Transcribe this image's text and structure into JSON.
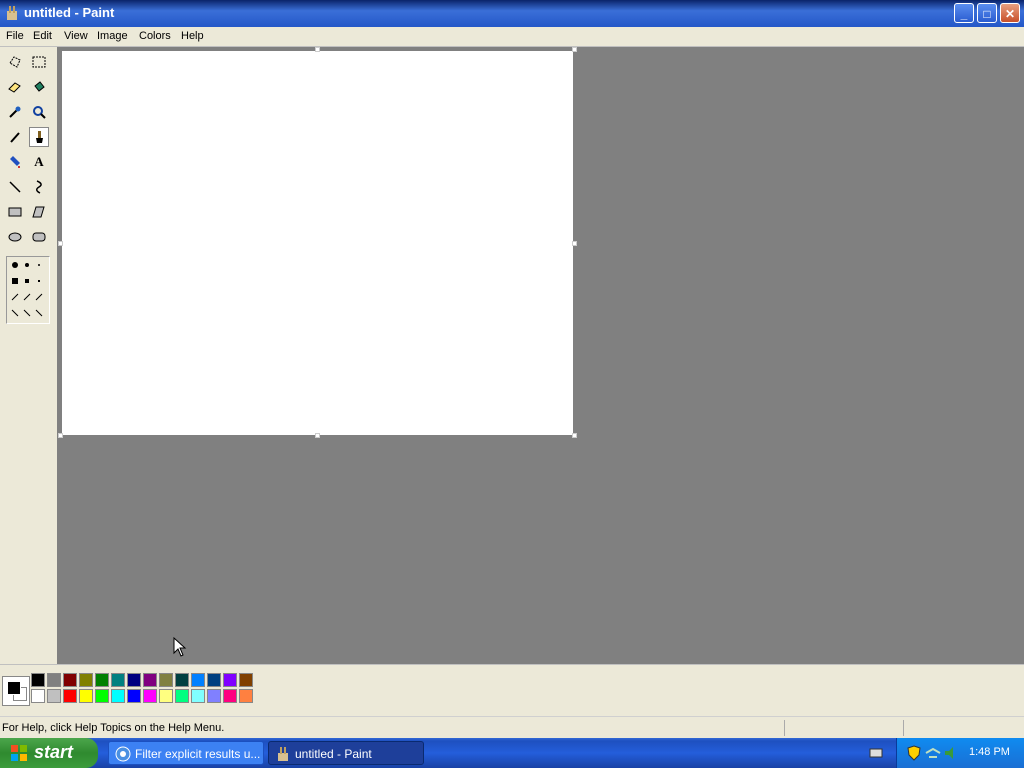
{
  "window": {
    "title": "untitled - Paint",
    "min_icon": "minimize-icon",
    "max_icon": "restore-icon",
    "close_icon": "close-icon"
  },
  "menu": [
    "File",
    "Edit",
    "View",
    "Image",
    "Colors",
    "Help"
  ],
  "tools": [
    "free-form-select-icon",
    "select-icon",
    "eraser-icon",
    "fill-icon",
    "pick-color-icon",
    "magnifier-icon",
    "pencil-icon",
    "brush-icon",
    "airbrush-icon",
    "text-icon",
    "line-icon",
    "curve-icon",
    "rectangle-icon",
    "polygon-icon",
    "ellipse-icon",
    "rounded-rectangle-icon"
  ],
  "selected_tool": "brush-icon",
  "palette": {
    "foreground": "#000000",
    "background": "#ffffff",
    "top": [
      "#000000",
      "#808080",
      "#800000",
      "#808000",
      "#008000",
      "#008080",
      "#000080",
      "#800080",
      "#808040",
      "#004040",
      "#0080ff",
      "#004080",
      "#8000ff",
      "#804000"
    ],
    "bottom": [
      "#ffffff",
      "#c0c0c0",
      "#ff0000",
      "#ffff00",
      "#00ff00",
      "#00ffff",
      "#0000ff",
      "#ff00ff",
      "#ffff80",
      "#00ff80",
      "#80ffff",
      "#8080ff",
      "#ff0080",
      "#ff8040"
    ]
  },
  "status": {
    "help": "For Help, click Help Topics on the Help Menu."
  },
  "taskbar": {
    "start": "start",
    "tasks": [
      {
        "label": "Filter explicit results u...",
        "icon": "browser-icon"
      },
      {
        "label": "untitled - Paint",
        "icon": "paint-icon"
      }
    ],
    "clock": "1:48 PM"
  }
}
